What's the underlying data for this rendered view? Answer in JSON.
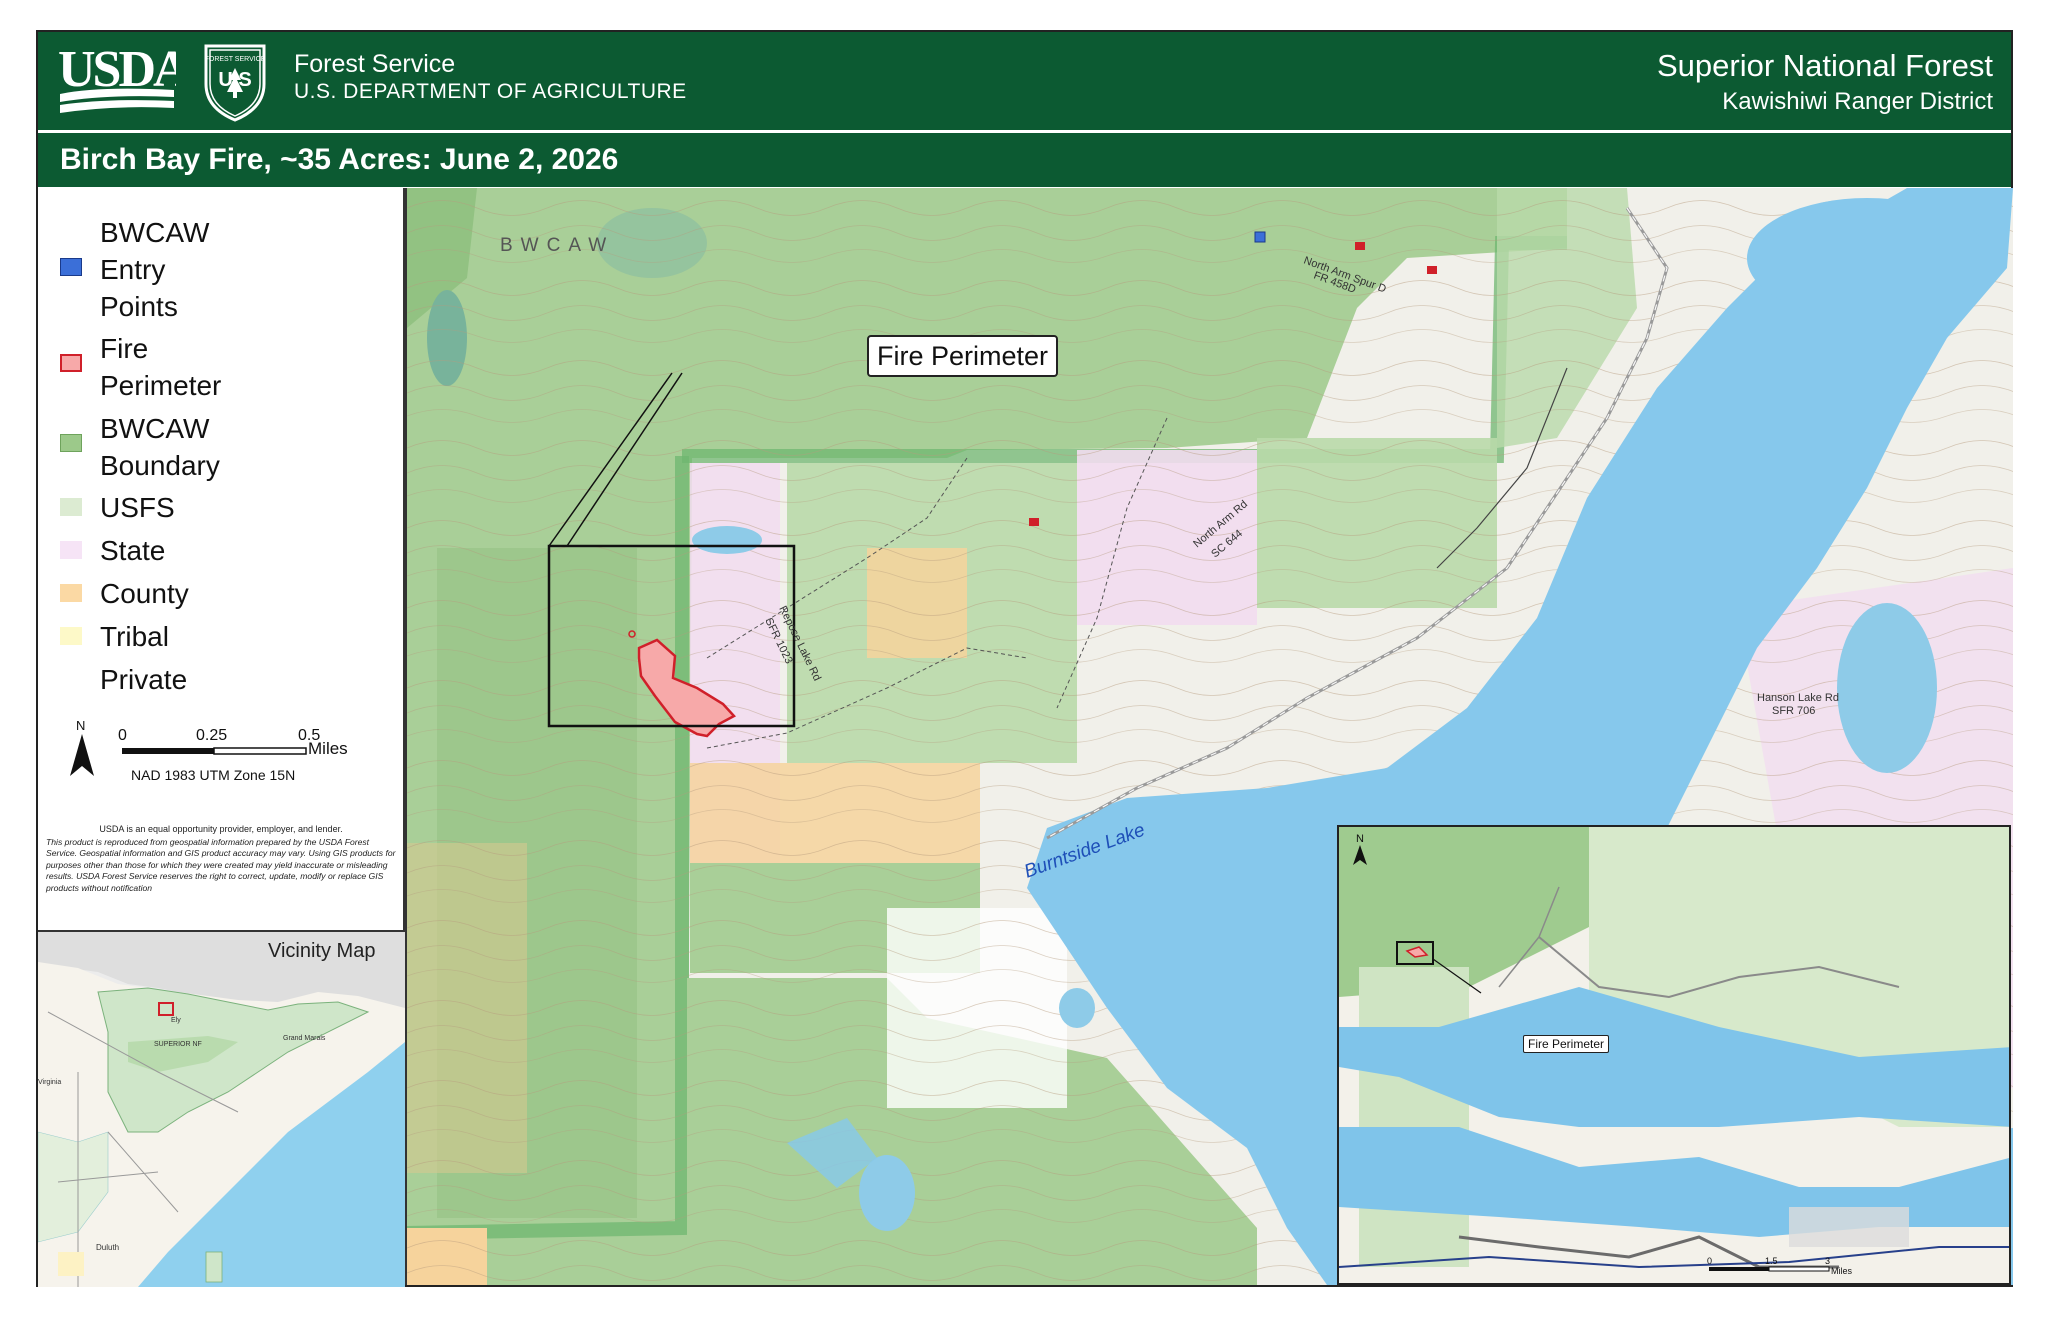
{
  "header": {
    "logo_text": "USDA",
    "shield_text": "FOREST SERVICE",
    "agency_name": "Forest Service",
    "department": "U.S. DEPARTMENT OF AGRICULTURE",
    "forest": "Superior National Forest",
    "district": "Kawishiwi Ranger District"
  },
  "title": "Birch Bay Fire, ~35 Acres: June 2, 2026",
  "legend": {
    "items": [
      {
        "label_lines": [
          "BWCAW",
          "Entry",
          "Points"
        ],
        "color": "#3b6fd8"
      },
      {
        "label_lines": [
          "Fire",
          "Perimeter"
        ],
        "color": "#f7a9a9"
      },
      {
        "label_lines": [
          "BWCAW",
          "Boundary"
        ],
        "color": "#9cc98a"
      },
      {
        "label_lines": [
          "USFS"
        ],
        "color": "#dcebd2"
      },
      {
        "label_lines": [
          "State"
        ],
        "color": "#f6e4f6"
      },
      {
        "label_lines": [
          "County"
        ],
        "color": "#fbd9a4"
      },
      {
        "label_lines": [
          "Tribal"
        ],
        "color": "#fdf9c8"
      },
      {
        "label_lines": [
          "Private"
        ],
        "color": "#ffffff"
      }
    ]
  },
  "scale_bar": {
    "north": "N",
    "ticks": [
      "0",
      "0.25",
      "0.5"
    ],
    "unit": "Miles",
    "projection": "NAD 1983 UTM Zone 15N"
  },
  "disclaimer": {
    "equal_opportunity": "USDA is an equal opportunity provider, employer, and lender.",
    "text": "This product is reproduced from geospatial information prepared by the USDA Forest Service. Geospatial information and GIS product accuracy may vary. Using GIS products for purposes other than those for which they were created may yield inaccurate or misleading results. USDA Forest Service reserves the right to correct, update, modify or replace GIS products without notification"
  },
  "vicinity_map": {
    "title": "Vicinity Map",
    "labels": {
      "forest": "SUPERIOR NF",
      "grand_marais": "Grand Marais",
      "duluth": "Duluth",
      "ely": "Ely",
      "virginia": "Virginia"
    }
  },
  "main_map": {
    "wilderness_label": "BWCAW",
    "callout": "Fire Perimeter",
    "lake_name": "Burntside Lake",
    "roads": [
      {
        "name": "North Arm Spur D",
        "sub": "FR 458D"
      },
      {
        "name": "North Arm Rd",
        "sub": "SC 644"
      },
      {
        "name": "Repose Lake Rd",
        "sub": "SFR 1023"
      },
      {
        "name": "Hanson Lake Rd",
        "sub": "SFR 706"
      }
    ]
  },
  "inset_map": {
    "callout": "Fire Perimeter",
    "north": "N",
    "scale_ticks": [
      "0",
      "1.5",
      "3"
    ],
    "scale_unit": "Miles"
  }
}
